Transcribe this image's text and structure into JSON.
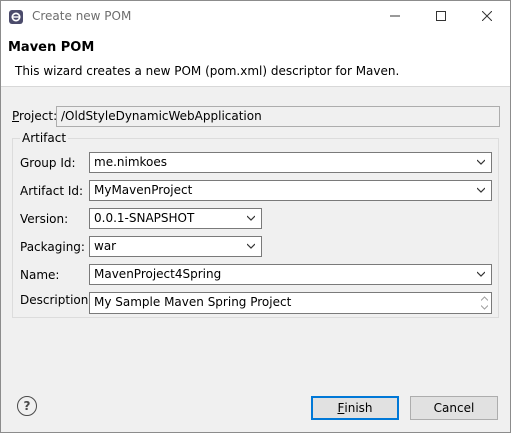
{
  "window": {
    "title": "Create new POM"
  },
  "header": {
    "title": "Maven POM",
    "description": "This wizard creates a new POM (pom.xml) descriptor for Maven."
  },
  "project": {
    "mnemonic": "P",
    "label_rest": "roject:",
    "value": "/OldStyleDynamicWebApplication"
  },
  "artifact": {
    "group_title": "Artifact",
    "group_id": {
      "label": "Group Id:",
      "value": "me.nimkoes"
    },
    "artifact_id": {
      "label": "Artifact Id:",
      "value": "MyMavenProject"
    },
    "version": {
      "label": "Version:",
      "value": "0.0.1-SNAPSHOT"
    },
    "packaging": {
      "label": "Packaging:",
      "value": "war"
    },
    "name": {
      "label": "Name:",
      "value": "MavenProject4Spring"
    },
    "description": {
      "label": "Description:",
      "value": "My Sample Maven Spring Project"
    }
  },
  "buttons": {
    "help": "?",
    "finish_mnemonic": "F",
    "finish_rest": "inish",
    "cancel": "Cancel"
  },
  "icons": {
    "app": "eclipse-app-icon",
    "minimize": "minimize-icon",
    "maximize": "maximize-icon",
    "close": "close-icon",
    "dropdown": "chevron-down-icon",
    "help": "help-icon"
  },
  "colors": {
    "default_button_border": "#0078d7",
    "title_text": "#6d6d6d"
  }
}
